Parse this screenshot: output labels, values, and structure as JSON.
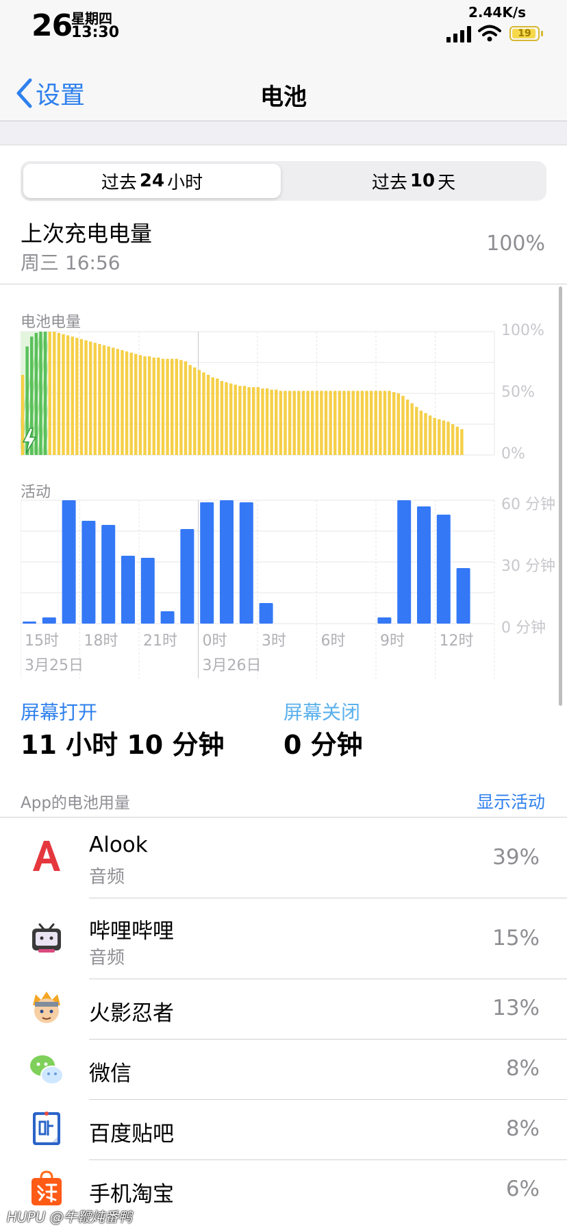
{
  "status_bar": {
    "day": "26",
    "weekday": "星期四",
    "time": "13:30",
    "net_speed": "2.44K/s",
    "battery_level": "19"
  },
  "nav": {
    "back_label": "设置",
    "title": "电池"
  },
  "segment": {
    "active_prefix": "过去",
    "active_num": "24",
    "active_suffix": "小时",
    "inactive_prefix": "过去",
    "inactive_num": "10",
    "inactive_suffix": "天"
  },
  "last_charge": {
    "label": "上次充电电量",
    "time": "周三 16:56",
    "value": "100%"
  },
  "battery_chart": {
    "label": "电池电量",
    "y_ticks": [
      "100%",
      "50%",
      "0%"
    ]
  },
  "activity_chart": {
    "label": "活动",
    "y_ticks": [
      "60 分钟",
      "30 分钟",
      "0 分钟"
    ],
    "x_ticks": [
      "15时",
      "18时",
      "21时",
      "0时",
      "3时",
      "6时",
      "9时",
      "12时"
    ],
    "dates": [
      "3月25日",
      "3月26日"
    ]
  },
  "chart_data": [
    {
      "type": "bar",
      "title": "电池电量",
      "ylim": [
        0,
        100
      ],
      "y_ticks": [
        "0%",
        "50%",
        "100%"
      ],
      "charging_color": "#5ac05a",
      "discharge_color": "#f5cf48",
      "values": [
        65,
        88,
        96,
        99,
        100,
        100,
        100,
        100,
        99,
        98,
        97,
        96,
        95,
        94,
        93,
        92,
        91,
        90,
        89,
        88,
        87,
        86,
        85,
        84,
        83,
        82,
        81,
        80,
        80,
        79,
        79,
        78,
        78,
        78,
        78,
        77,
        76,
        73,
        71,
        69,
        67,
        65,
        63,
        62,
        60,
        59,
        58,
        57,
        56,
        56,
        55,
        55,
        55,
        54,
        54,
        53,
        53,
        52,
        52,
        52,
        52,
        52,
        52,
        52,
        52,
        52,
        52,
        52,
        52,
        52,
        52,
        52,
        52,
        52,
        52,
        52,
        52,
        52,
        52,
        52,
        52,
        52,
        51,
        50,
        48,
        45,
        42,
        39,
        36,
        34,
        32,
        30,
        29,
        28,
        27,
        25,
        23,
        21
      ]
    },
    {
      "type": "bar",
      "title": "活动",
      "ylim": [
        0,
        60
      ],
      "y_ticks": [
        "0 分钟",
        "30 分钟",
        "60 分钟"
      ],
      "categories": [
        "14时",
        "15时",
        "16时",
        "17时",
        "18时",
        "19时",
        "20时",
        "21时",
        "22时",
        "23时",
        "0时",
        "1时",
        "2时",
        "3时",
        "4时",
        "5时",
        "6时",
        "7时",
        "8时",
        "9时",
        "10时",
        "11时",
        "12时"
      ],
      "color": "#3478f6",
      "values": [
        1,
        3,
        60,
        50,
        48,
        33,
        32,
        6,
        46,
        59,
        60,
        59,
        10,
        0,
        0,
        0,
        0,
        0,
        3,
        60,
        57,
        53,
        27
      ]
    }
  ],
  "screen": {
    "on_label": "屏幕打开",
    "on_value": "11 小时 10 分钟",
    "off_label": "屏幕关闭",
    "off_value": "0 分钟"
  },
  "apps": {
    "header": "App的电池用量",
    "show_activity": "显示活动",
    "items": [
      {
        "name": "Alook",
        "sub": "音频",
        "pct": "39%",
        "icon": "alook-icon"
      },
      {
        "name": "哔哩哔哩",
        "sub": "音频",
        "pct": "15%",
        "icon": "bilibili-icon"
      },
      {
        "name": "火影忍者",
        "sub": "",
        "pct": "13%",
        "icon": "naruto-icon"
      },
      {
        "name": "微信",
        "sub": "",
        "pct": "8%",
        "icon": "wechat-icon"
      },
      {
        "name": "百度贴吧",
        "sub": "",
        "pct": "8%",
        "icon": "tieba-icon"
      },
      {
        "name": "手机淘宝",
        "sub": "",
        "pct": "6%",
        "icon": "taobao-icon"
      }
    ]
  },
  "watermark": "HUPU @牛鞭炖番鸭"
}
